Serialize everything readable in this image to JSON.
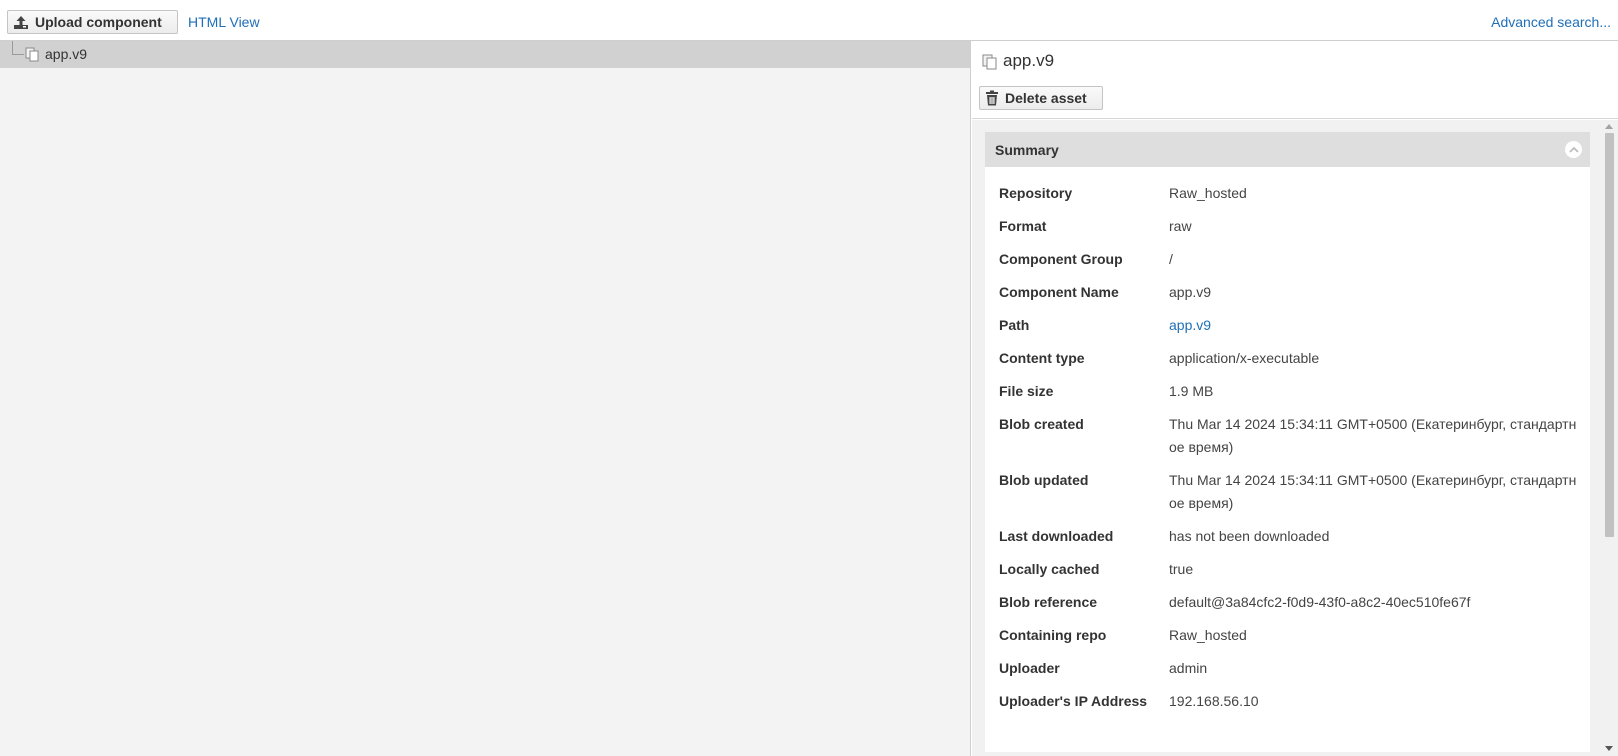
{
  "toolbar": {
    "upload_label": "Upload component",
    "html_view_label": "HTML View",
    "advanced_search_label": "Advanced search..."
  },
  "tree": {
    "items": [
      {
        "label": "app.v9",
        "icon": "asset-files-icon"
      }
    ]
  },
  "detail": {
    "title": "app.v9",
    "delete_label": "Delete asset",
    "summary": {
      "heading": "Summary",
      "rows": [
        {
          "key": "Repository",
          "value": "Raw_hosted"
        },
        {
          "key": "Format",
          "value": "raw"
        },
        {
          "key": "Component Group",
          "value": "/"
        },
        {
          "key": "Component Name",
          "value": "app.v9"
        },
        {
          "key": "Path",
          "value": "app.v9"
        },
        {
          "key": "Content type",
          "value": "application/x-executable"
        },
        {
          "key": "File size",
          "value": "1.9 MB"
        },
        {
          "key": "Blob created",
          "value": "Thu Mar 14 2024 15:34:11 GMT+0500 (Екатеринбург, стандартное время)"
        },
        {
          "key": "Blob updated",
          "value": "Thu Mar 14 2024 15:34:11 GMT+0500 (Екатеринбург, стандартное время)"
        },
        {
          "key": "Last downloaded",
          "value": "has not been downloaded"
        },
        {
          "key": "Locally cached",
          "value": "true"
        },
        {
          "key": "Blob reference",
          "value": "default@3a84cfc2-f0d9-43f0-a8c2-40ec510fe67f"
        },
        {
          "key": "Containing repo",
          "value": "Raw_hosted"
        },
        {
          "key": "Uploader",
          "value": "admin"
        },
        {
          "key": "Uploader's IP Address",
          "value": "192.168.56.10"
        }
      ]
    }
  },
  "colors": {
    "link": "#1f6fb8",
    "selected_row": "#d1d1d1",
    "panel_header": "#dedede"
  }
}
